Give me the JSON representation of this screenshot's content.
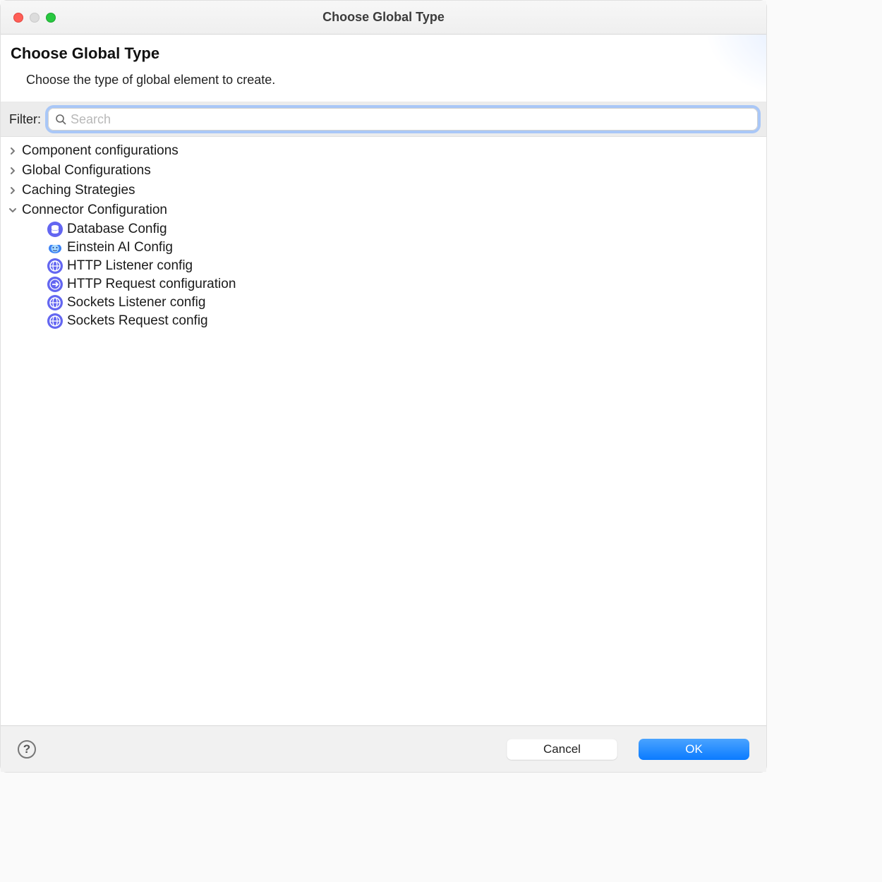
{
  "window": {
    "title": "Choose Global Type"
  },
  "header": {
    "heading": "Choose Global Type",
    "subtitle": "Choose the type of global element to create."
  },
  "filter": {
    "label": "Filter:",
    "placeholder": "Search",
    "value": ""
  },
  "tree": {
    "groups": [
      {
        "label": "Component configurations",
        "expanded": false,
        "items": []
      },
      {
        "label": "Global Configurations",
        "expanded": false,
        "items": []
      },
      {
        "label": "Caching Strategies",
        "expanded": false,
        "items": []
      },
      {
        "label": "Connector Configuration",
        "expanded": true,
        "items": [
          {
            "label": "Database Config",
            "icon": "database-icon"
          },
          {
            "label": "Einstein AI Config",
            "icon": "einstein-icon"
          },
          {
            "label": "HTTP Listener config",
            "icon": "http-icon"
          },
          {
            "label": "HTTP Request configuration",
            "icon": "http-arrow-icon"
          },
          {
            "label": "Sockets Listener config",
            "icon": "socket-icon"
          },
          {
            "label": "Sockets Request config",
            "icon": "socket-icon"
          }
        ]
      }
    ]
  },
  "footer": {
    "cancel": "Cancel",
    "ok": "OK"
  }
}
